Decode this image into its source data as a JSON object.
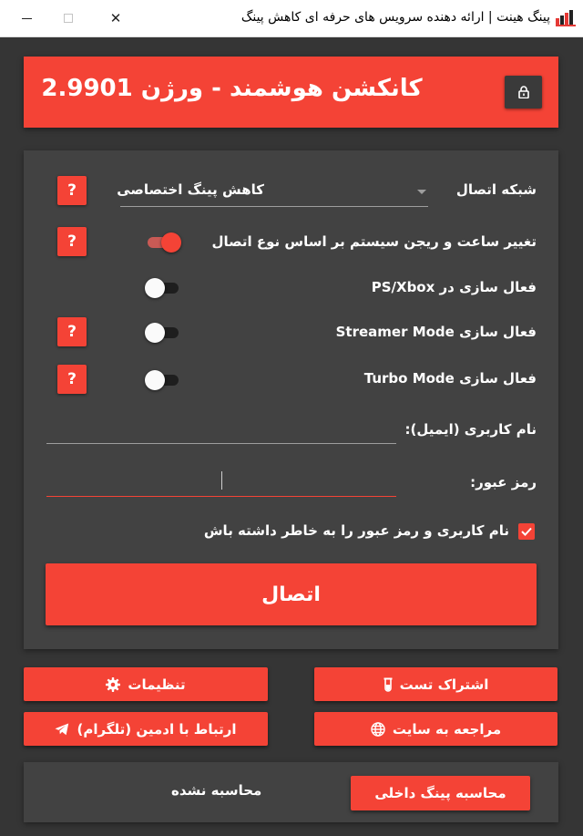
{
  "window": {
    "title": "پینگ هینت | ارائه دهنده سرویس های حرفه ای کاهش پینگ",
    "logo_icon": "pinghint-logo-icon",
    "minimize_icon": "minimize-icon",
    "maximize_icon": "maximize-icon",
    "close_icon": "close-icon",
    "close_glyph": "✕"
  },
  "header": {
    "title": "کانکشن هوشمند - ورژن 2.9901",
    "lock_icon": "lock-icon"
  },
  "form": {
    "network": {
      "label": "شبکه اتصال",
      "selected": "کاهش پینگ اختصاصی",
      "help": "?"
    },
    "time_region": {
      "label": "تغییر ساعت و ریجن سیستم بر اساس نوع اتصال",
      "on": true,
      "help": "?"
    },
    "ps_xbox": {
      "label": "فعال سازی در PS/Xbox",
      "on": false
    },
    "streamer": {
      "label": "فعال سازی Streamer Mode",
      "on": false,
      "help": "?"
    },
    "turbo": {
      "label": "فعال سازی Turbo Mode",
      "on": false,
      "help": "?"
    },
    "username": {
      "label": "نام کاربری (ایمیل):",
      "value": ""
    },
    "password": {
      "label": "رمز عبور:",
      "value": ""
    },
    "remember": {
      "label": "نام کاربری و رمز عبور را به خاطر داشته باش",
      "checked": true
    },
    "connect_label": "اتصال"
  },
  "actions": {
    "test_account": {
      "label": "اشتراک تست",
      "icon": "test-tube-icon"
    },
    "settings": {
      "label": "تنظیمات",
      "icon": "gear-icon"
    },
    "website": {
      "label": "مراجعه به سایت",
      "icon": "globe-icon"
    },
    "telegram": {
      "label": "ارتباط با ادمین (تلگرام)",
      "icon": "telegram-icon"
    }
  },
  "footer": {
    "ping_button": "محاسبه پینگ داخلی",
    "ping_status": "محاسبه نشده"
  },
  "colors": {
    "accent": "#f44336",
    "background": "#353535",
    "panel": "#424242"
  }
}
